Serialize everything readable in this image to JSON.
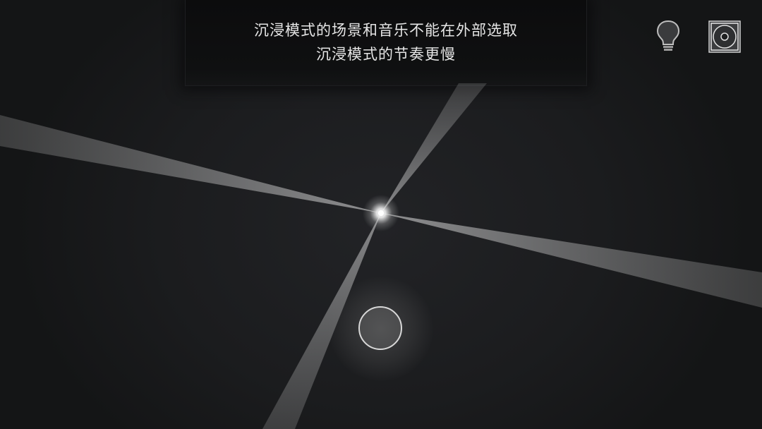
{
  "messages": {
    "line1": "沉浸模式的场景和音乐不能在外部选取",
    "line2": "沉浸模式的节奏更慢"
  },
  "toolbar": {
    "hint_icon": "lightbulb-icon",
    "disc_icon": "music-disc-icon"
  },
  "colors": {
    "background": "#1a1b1d",
    "ray": "#d6d6d6",
    "text": "#e6e6e6",
    "ring": "#d8d8d8"
  }
}
